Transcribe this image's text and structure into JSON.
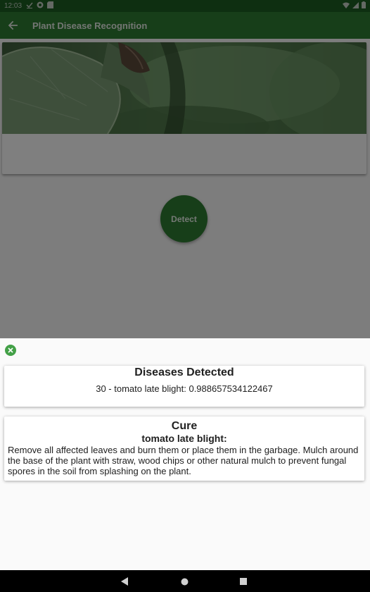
{
  "status_bar": {
    "time": "12:03"
  },
  "app_bar": {
    "title": "Plant Disease Recognition",
    "back_icon": "arrow-back-icon"
  },
  "detect_button": {
    "label": "Detect"
  },
  "result_sheet": {
    "close_icon": "close-circle-icon",
    "detected": {
      "heading": "Diseases Detected",
      "result": "30 - tomato late blight: 0.988657534122467"
    },
    "cure": {
      "heading": "Cure",
      "disease_name": "tomato late blight:",
      "text": "Remove all affected leaves and burn them or place them in the garbage. Mulch around the base of the plant with straw, wood chips or other natural mulch to prevent fungal spores in the soil from splashing on the plant."
    }
  },
  "colors": {
    "primary": "#2e7d32",
    "status_bar": "#1d5f22",
    "close_icon": "#43a047"
  }
}
